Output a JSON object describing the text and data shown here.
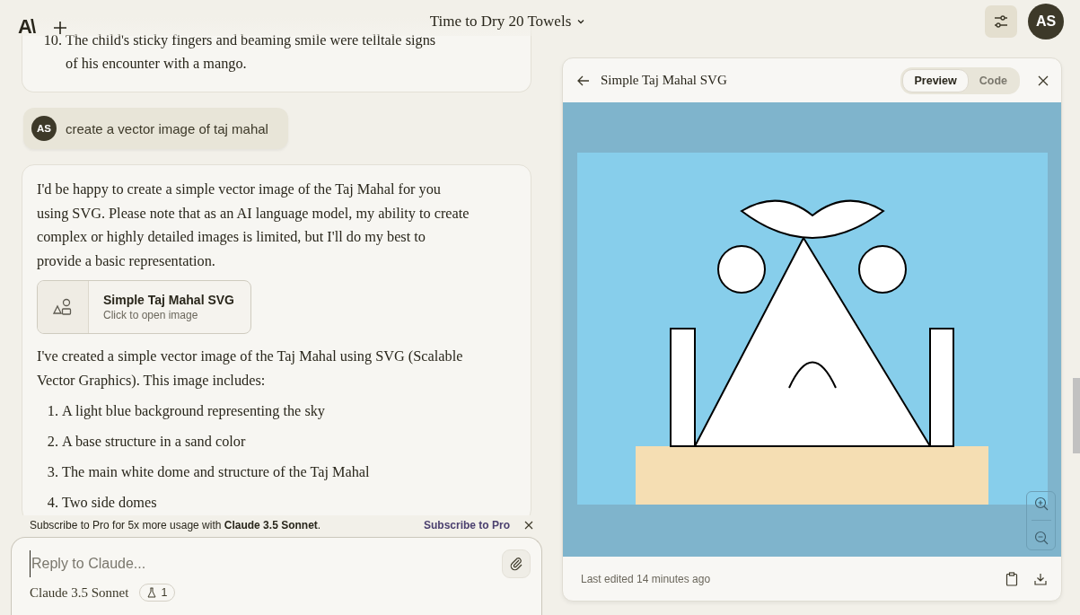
{
  "top_bar": {
    "logo": "A\\",
    "title": "Time to Dry 20 Towels",
    "avatar": "AS"
  },
  "chat": {
    "previous_reply": {
      "items": [
        {
          "number": "10.",
          "text": "The child's sticky fingers and beaming smile were telltale signs of his encounter with a mango."
        }
      ]
    },
    "user_message": {
      "avatar": "AS",
      "text": "create a vector image of taj mahal"
    },
    "assistant_reply": {
      "blocks": [
        {
          "kind": "paragraph",
          "text": "I'd be happy to create a simple vector image of the Taj Mahal for you using SVG. Please note that as an AI language model, my ability to create complex or highly detailed images is limited, but I'll do my best to provide a basic representation."
        },
        {
          "kind": "artifact",
          "title": "Simple Taj Mahal SVG",
          "subtitle": "Click to open image"
        },
        {
          "kind": "paragraph",
          "text": "I've created a simple vector image of the Taj Mahal using SVG (Scalable Vector Graphics). This image includes:"
        },
        {
          "kind": "list",
          "items": [
            {
              "number": "1.",
              "text": "A light blue background representing the sky"
            },
            {
              "number": "2.",
              "text": "A base structure in a sand color"
            },
            {
              "number": "3.",
              "text": "The main white dome and structure of the Taj Mahal"
            },
            {
              "number": "4.",
              "text": "Two side domes"
            }
          ]
        }
      ]
    }
  },
  "subscribe_banner": {
    "text": "Subscribe to Pro for 5x more usage with **Claude 3.5 Sonnet**.",
    "link": "Subscribe to Pro"
  },
  "composer": {
    "placeholder": "Reply to Claude...",
    "model": "Claude 3.5 Sonnet",
    "badge_count": "1"
  },
  "artifact_panel": {
    "title": "Simple Taj Mahal SVG",
    "tabs": [
      {
        "label": "Preview",
        "selected": true
      },
      {
        "label": "Code",
        "selected": false
      }
    ],
    "footer": "Last edited 14 minutes ago"
  }
}
